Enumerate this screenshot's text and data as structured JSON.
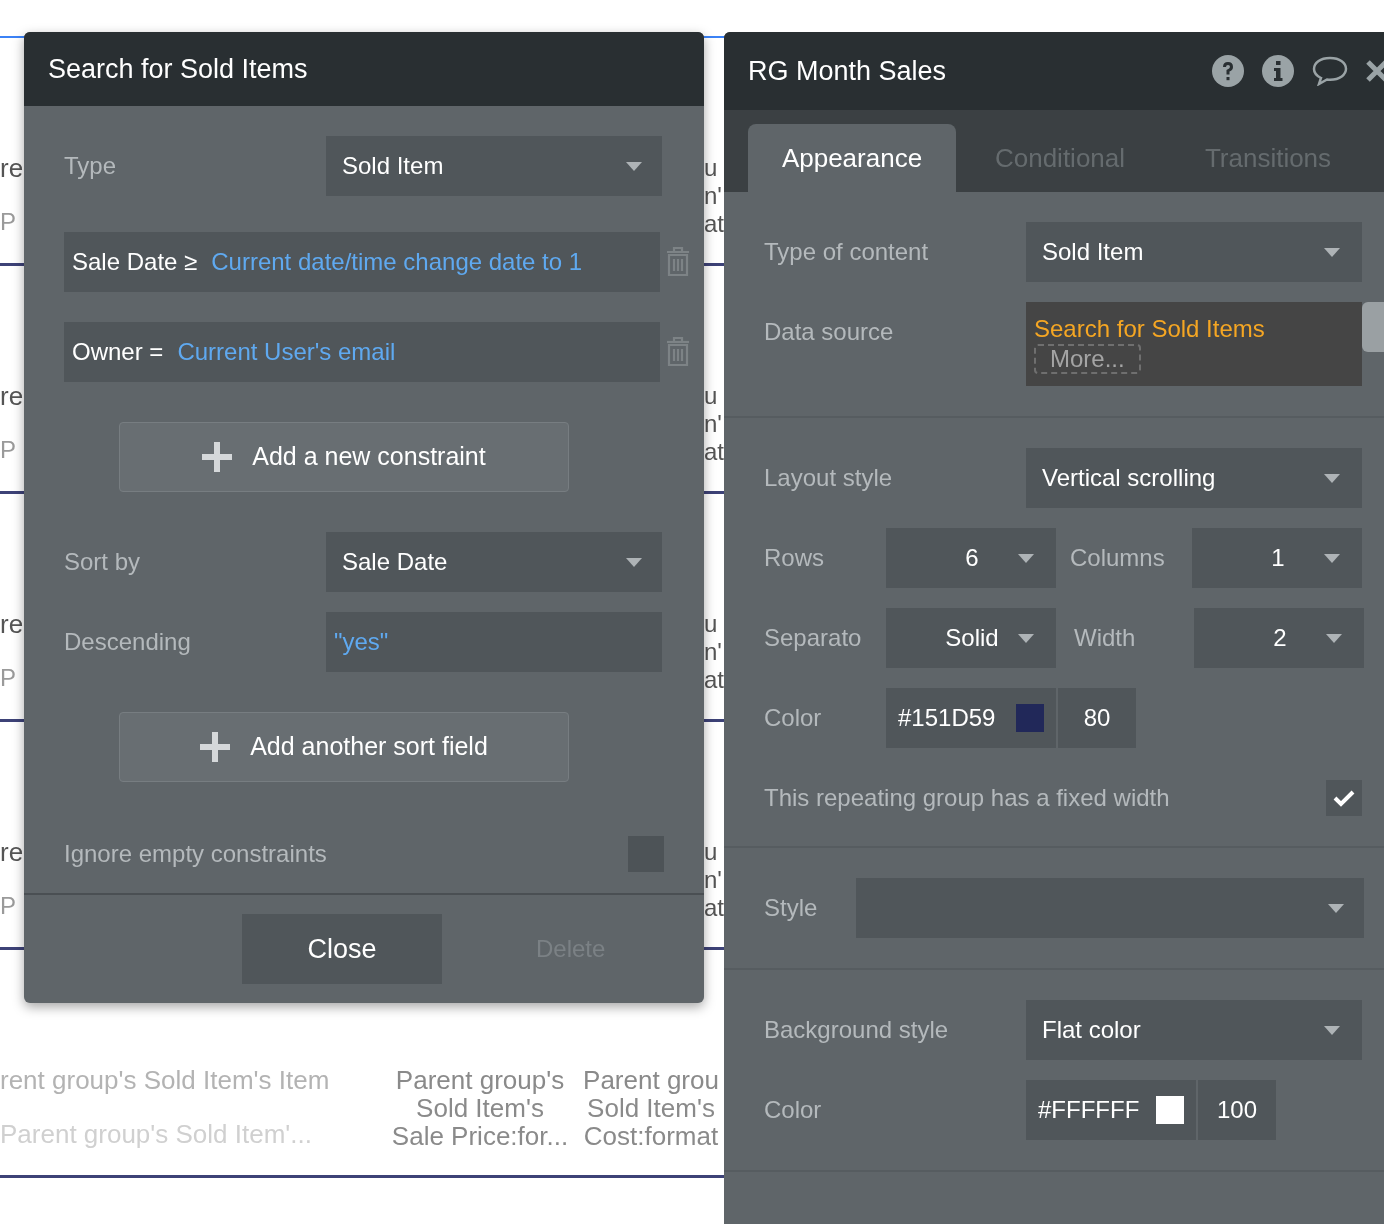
{
  "canvas": {
    "rows": [
      {
        "col_1": "re",
        "col_2": "P",
        "col_3": [
          "u",
          "n'",
          "at"
        ]
      },
      {
        "col_1": "re",
        "col_2": "P",
        "col_3": [
          "u",
          "n'",
          "at"
        ]
      },
      {
        "col_1": "re",
        "col_2": "P",
        "col_3": [
          "u",
          "n'",
          "at"
        ]
      },
      {
        "col_1": "re",
        "col_2": "P",
        "col_3": [
          "u",
          "n'",
          "at"
        ]
      },
      {
        "col_1": "rent group's Sold Item's Item",
        "col_2": "Parent group's Sold Item'...",
        "col_4": [
          "Parent group's",
          "Sold Item's",
          "Sale Price:for..."
        ],
        "col_3": [
          "Parent grou",
          "Sold Item's",
          "Cost:format"
        ]
      }
    ]
  },
  "search_panel": {
    "title": "Search for Sold Items",
    "type": {
      "label": "Type",
      "value": "Sold Item"
    },
    "constraints": [
      {
        "field": "Sale Date ≥",
        "expression": "Current date/time change date to 1"
      },
      {
        "field": "Owner =",
        "expression": "Current User's email"
      }
    ],
    "add_constraint_button": "Add a new constraint",
    "sort_by": {
      "label": "Sort by",
      "value": "Sale Date"
    },
    "descending": {
      "label": "Descending",
      "value": "\"yes\""
    },
    "add_sort_button": "Add another sort field",
    "ignore_empty": {
      "label": "Ignore empty constraints",
      "checked": false
    },
    "buttons": [
      {
        "label": "Close",
        "disabled": false
      },
      {
        "label": "Delete",
        "disabled": true
      }
    ]
  },
  "property_panel": {
    "title": "RG Month Sales",
    "tabs": [
      {
        "label": "Appearance",
        "selected": true
      },
      {
        "label": "Conditional",
        "selected": false
      },
      {
        "label": "Transitions",
        "selected": false
      }
    ],
    "type_of_content": {
      "label": "Type of content",
      "value": "Sold Item"
    },
    "data_source": {
      "label": "Data source",
      "value": "Search for Sold Items",
      "more": "More..."
    },
    "layout_style": {
      "label": "Layout style",
      "value": "Vertical scrolling"
    },
    "rows": {
      "label": "Rows",
      "value": "6"
    },
    "columns": {
      "label": "Columns",
      "value": "1"
    },
    "separator": {
      "label": "Separato",
      "value": "Solid"
    },
    "separator_width": {
      "label": "Width",
      "value": "2"
    },
    "separator_color": {
      "label": "Color",
      "hex": "#151D59",
      "opacity": "80"
    },
    "fixed_width": {
      "label": "This repeating group has a fixed width",
      "checked": true
    },
    "style": {
      "label": "Style"
    },
    "background_style": {
      "label": "Background style",
      "value": "Flat color"
    },
    "background_color": {
      "label": "Color",
      "hex": "#FFFFFF",
      "opacity": "100"
    }
  }
}
